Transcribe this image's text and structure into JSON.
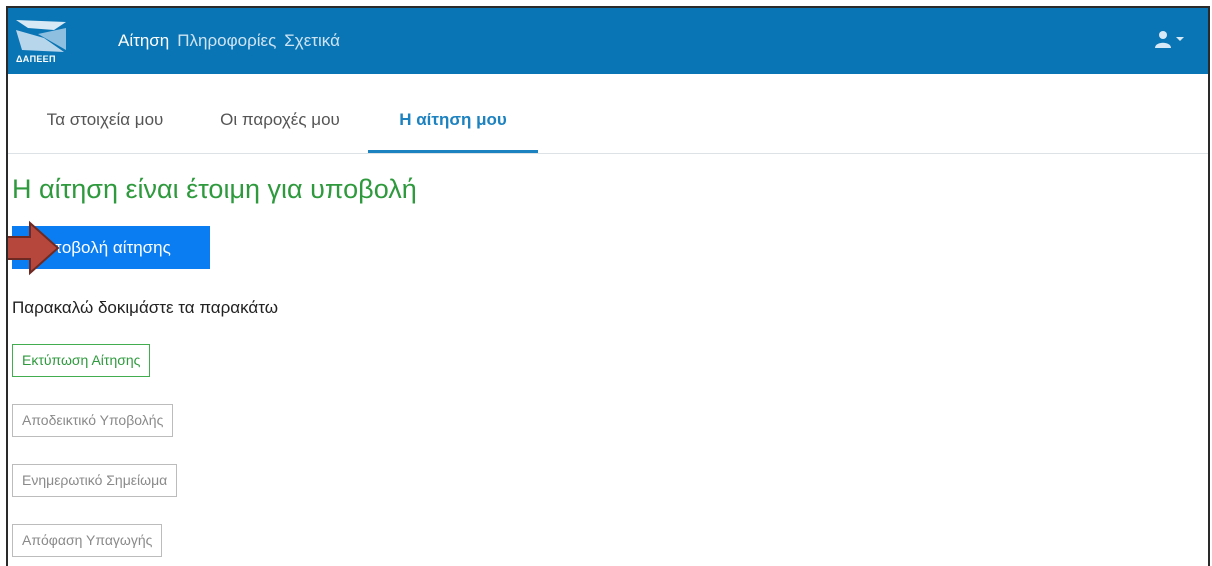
{
  "navbar": {
    "logo_text": "ΔΑΠΕΕΠ",
    "links": [
      {
        "label": "Αίτηση",
        "active": true
      },
      {
        "label": "Πληροφορίες",
        "active": false
      },
      {
        "label": "Σχετικά",
        "active": false
      }
    ],
    "user_icon": "user-icon"
  },
  "tabs": [
    {
      "label": "Τα στοιχεία μου",
      "active": false
    },
    {
      "label": "Οι παροχές μου",
      "active": false
    },
    {
      "label": "Η αίτηση μου",
      "active": true
    }
  ],
  "main": {
    "headline": "Η αίτηση είναι έτοιμη για υποβολή",
    "submit_label": "Υποβολή αίτησης",
    "helper_text": "Παρακαλώ δοκιμάστε τα παρακάτω",
    "documents": [
      {
        "label": "Εκτύπωση Αίτησης",
        "enabled": true
      },
      {
        "label": "Αποδεικτικό Υποβολής",
        "enabled": false
      },
      {
        "label": "Ενημερωτικό Σημείωμα",
        "enabled": false
      },
      {
        "label": "Απόφαση Υπαγωγής",
        "enabled": false
      }
    ]
  },
  "colors": {
    "navbar": "#0a75b4",
    "active_tab": "#1d82c0",
    "success_green": "#2e9a3d",
    "submit_blue": "#0b7df2",
    "annotation_arrow": "#b5473c"
  }
}
